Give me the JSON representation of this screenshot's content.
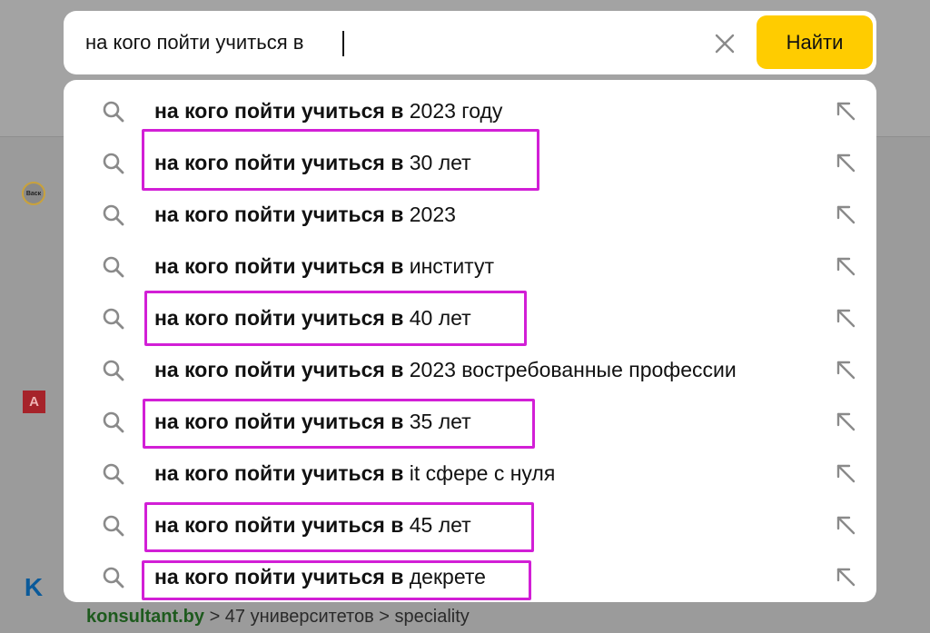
{
  "search": {
    "query": "на кого пойти учиться в ",
    "submit_label": "Найти",
    "clear_icon": "close-icon"
  },
  "suggestions": [
    {
      "prefix": "на кого пойти учиться в",
      "suffix": " 2023 году",
      "highlighted": false
    },
    {
      "prefix": "на кого пойти учиться в",
      "suffix": " 30 лет",
      "highlighted": true
    },
    {
      "prefix": "на кого пойти учиться в",
      "suffix": " 2023",
      "highlighted": false
    },
    {
      "prefix": "на кого пойти учиться в",
      "suffix": " институт",
      "highlighted": false
    },
    {
      "prefix": "на кого пойти учиться в",
      "suffix": " 40 лет",
      "highlighted": true
    },
    {
      "prefix": "на кого пойти учиться в",
      "suffix": " 2023 востребованные профессии",
      "highlighted": false
    },
    {
      "prefix": "на кого пойти учиться в",
      "suffix": " 35 лет",
      "highlighted": true
    },
    {
      "prefix": "на кого пойти учиться в",
      "suffix": " it сфере с нуля",
      "highlighted": false
    },
    {
      "prefix": "на кого пойти учиться в",
      "suffix": " 45 лет",
      "highlighted": true
    },
    {
      "prefix": "на кого пойти учиться в",
      "suffix": " декрете",
      "highlighted": true
    }
  ],
  "background": {
    "icon1_text": "Васк",
    "icon2_text": "A",
    "icon3_text": "K",
    "breadcrumb_site": "konsultant.by",
    "breadcrumb_rest": " > 47 университетов > speciality"
  },
  "colors": {
    "submit_bg": "#ffcc00",
    "highlight": "#d21fd6",
    "overlay": "#9b9b9b"
  }
}
